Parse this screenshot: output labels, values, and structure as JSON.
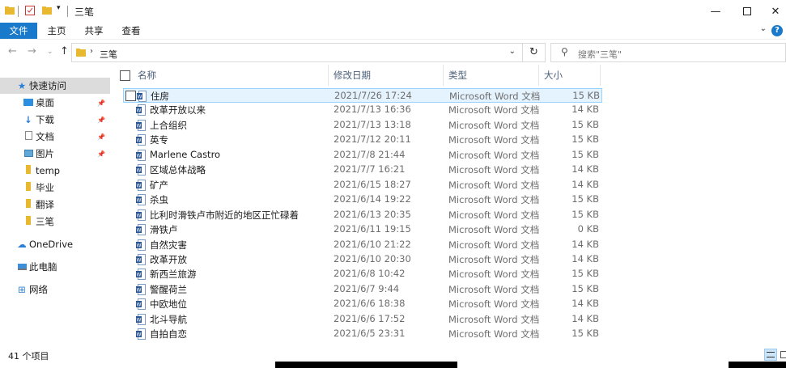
{
  "window": {
    "title": "三笔"
  },
  "ribbon": {
    "tabs": [
      "文件",
      "主页",
      "共享",
      "查看"
    ]
  },
  "address": {
    "path_item": "三笔",
    "search_placeholder": "搜索\"三笔\""
  },
  "nav": {
    "items": [
      {
        "label": "快速访问",
        "icon": "star-icon",
        "selected": true,
        "pinned": false
      },
      {
        "label": "桌面",
        "icon": "desktop-icon",
        "pinned": true
      },
      {
        "label": "下载",
        "icon": "download-icon",
        "pinned": true
      },
      {
        "label": "文档",
        "icon": "document-icon",
        "pinned": true
      },
      {
        "label": "图片",
        "icon": "picture-icon",
        "pinned": true
      },
      {
        "label": "temp",
        "icon": "folder-icon",
        "pinned": false
      },
      {
        "label": "毕业",
        "icon": "folder-icon",
        "pinned": false
      },
      {
        "label": "翻译",
        "icon": "folder-icon",
        "pinned": false
      },
      {
        "label": "三笔",
        "icon": "folder-icon",
        "pinned": false
      },
      {
        "label": "OneDrive",
        "icon": "cloud-icon",
        "pinned": false
      },
      {
        "label": "此电脑",
        "icon": "computer-icon",
        "pinned": false
      },
      {
        "label": "网络",
        "icon": "network-icon",
        "pinned": false
      }
    ]
  },
  "columns": {
    "name": "名称",
    "date": "修改日期",
    "type": "类型",
    "size": "大小"
  },
  "files": [
    {
      "name": "住房",
      "date": "2021/7/26 17:24",
      "type": "Microsoft Word 文档",
      "size": "15 KB"
    },
    {
      "name": "改革开放以来",
      "date": "2021/7/13 16:36",
      "type": "Microsoft Word 文档",
      "size": "14 KB"
    },
    {
      "name": "上合组织",
      "date": "2021/7/13 13:18",
      "type": "Microsoft Word 文档",
      "size": "15 KB"
    },
    {
      "name": "英专",
      "date": "2021/7/12 20:11",
      "type": "Microsoft Word 文档",
      "size": "15 KB"
    },
    {
      "name": "Marlene Castro",
      "date": "2021/7/8 21:44",
      "type": "Microsoft Word 文档",
      "size": "15 KB"
    },
    {
      "name": "区域总体战略",
      "date": "2021/7/7 16:21",
      "type": "Microsoft Word 文档",
      "size": "14 KB"
    },
    {
      "name": "矿产",
      "date": "2021/6/15 18:27",
      "type": "Microsoft Word 文档",
      "size": "14 KB"
    },
    {
      "name": "杀虫",
      "date": "2021/6/14 19:22",
      "type": "Microsoft Word 文档",
      "size": "15 KB"
    },
    {
      "name": "比利时滑铁卢市附近的地区正忙碌着",
      "date": "2021/6/13 20:35",
      "type": "Microsoft Word 文档",
      "size": "15 KB"
    },
    {
      "name": "滑铁卢",
      "date": "2021/6/11 19:15",
      "type": "Microsoft Word 文档",
      "size": "0 KB"
    },
    {
      "name": "自然灾害",
      "date": "2021/6/10 21:22",
      "type": "Microsoft Word 文档",
      "size": "14 KB"
    },
    {
      "name": "改革开放",
      "date": "2021/6/10 20:30",
      "type": "Microsoft Word 文档",
      "size": "14 KB"
    },
    {
      "name": "新西兰旅游",
      "date": "2021/6/8 10:42",
      "type": "Microsoft Word 文档",
      "size": "15 KB"
    },
    {
      "name": "警醒荷兰",
      "date": "2021/6/7 9:44",
      "type": "Microsoft Word 文档",
      "size": "15 KB"
    },
    {
      "name": "中欧地位",
      "date": "2021/6/6 18:38",
      "type": "Microsoft Word 文档",
      "size": "14 KB"
    },
    {
      "name": "北斗导航",
      "date": "2021/6/6 17:52",
      "type": "Microsoft Word 文档",
      "size": "14 KB"
    },
    {
      "name": "自拍自恋",
      "date": "2021/6/5 23:31",
      "type": "Microsoft Word 文档",
      "size": "15 KB"
    }
  ],
  "status": {
    "count": "41 个项目"
  },
  "colors": {
    "accent": "#1979ca",
    "selection": "#e5f3ff",
    "header_text": "#4c607a"
  }
}
